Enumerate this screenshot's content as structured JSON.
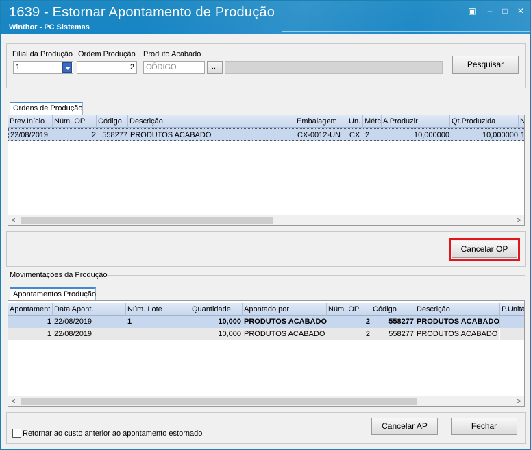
{
  "window": {
    "title": "1639 - Estornar Apontamento de Produção",
    "subtitle": "Winthor - PC Sistemas",
    "controls": [
      "▣",
      "–",
      "□",
      "✕"
    ]
  },
  "filters": {
    "filial_label": "Filial da Produção",
    "filial_value": "1",
    "ordem_label": "Ordem Produção",
    "ordem_value": "2",
    "produto_label": "Produto Acabado",
    "produto_placeholder": "CÓDIGO",
    "ellipsis_label": "...",
    "produto_desc_value": "",
    "search_label": "Pesquisar"
  },
  "ordens": {
    "tab_label": "Ordens de Produção",
    "columns": [
      "Prev.Início",
      "Núm. OP",
      "Código",
      "Descrição",
      "Embalagem",
      "Un.",
      "Métc",
      "A Produzir",
      "Qt.Produzida",
      "N"
    ],
    "rows": [
      [
        "22/08/2019",
        "2",
        "558277",
        "PRODUTOS ACABADO",
        "CX-0012-UN",
        "CX",
        "2",
        "10,000000",
        "10,000000",
        "1"
      ]
    ],
    "cancel_op_label": "Cancelar OP"
  },
  "movimentacoes": {
    "group_label": "Movimentações da Produção",
    "tab_label": "Apontamentos Produção",
    "columns": [
      "Apontament",
      "Data Apont.",
      "Núm. Lote",
      "Quantidade",
      "Apontado por",
      "Núm. OP",
      "Código",
      "Descrição",
      "P.Unita"
    ],
    "rows": [
      [
        "1",
        "22/08/2019",
        "1",
        "10,000",
        "PRODUTOS ACABADO",
        "2",
        "558277",
        "PRODUTOS ACABADO",
        ""
      ],
      [
        "1",
        "22/08/2019",
        "",
        "10,000",
        "PRODUTOS ACABADO",
        "2",
        "558277",
        "PRODUTOS ACABADO",
        ""
      ]
    ]
  },
  "footer": {
    "checkbox_label": "Retornar ao custo anterior ao apontamento estornado",
    "checkbox_checked": false,
    "cancel_ap_label": "Cancelar AP",
    "close_label": "Fechar"
  },
  "colors": {
    "titlebar": "#1a86c3",
    "highlight_border": "#e0161b",
    "selected_row": "#c7d7ee",
    "alt_row": "#e8e8e8"
  }
}
